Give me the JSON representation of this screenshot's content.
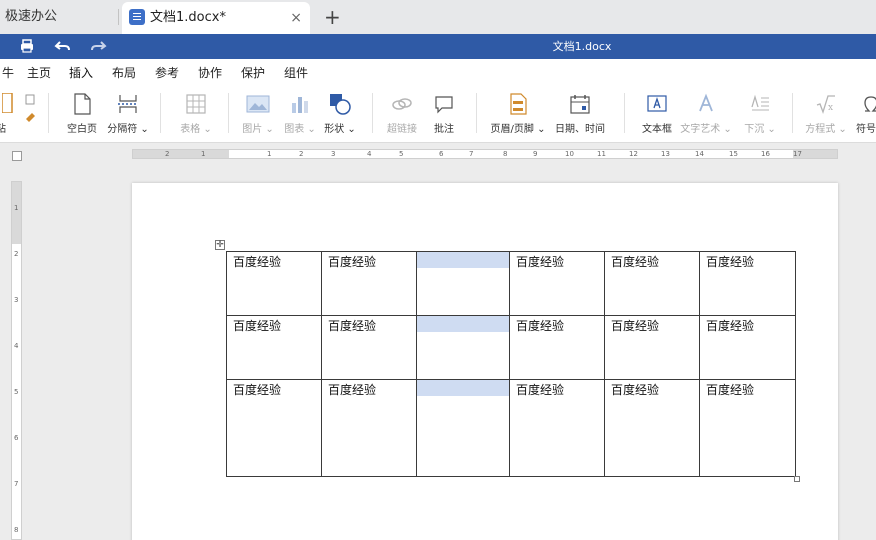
{
  "tabs": {
    "app_name": "极速办公",
    "document_tab": "文档1.docx*",
    "close_glyph": "×",
    "new_glyph": "+"
  },
  "titlebar": {
    "title": "文档1.docx",
    "icons": [
      "print-icon",
      "undo-icon",
      "redo-icon"
    ]
  },
  "menu": {
    "items": [
      "牛",
      "主页",
      "插入",
      "布局",
      "参考",
      "协作",
      "保护",
      "组件"
    ],
    "active": "插入"
  },
  "ribbon": {
    "partial_left_label": "粘",
    "items": [
      {
        "name": "blank-page",
        "label": "空白页",
        "enabled": true
      },
      {
        "name": "separator",
        "label": "分隔符 ⌄",
        "enabled": true
      },
      {
        "name": "table",
        "label": "表格 ⌄",
        "enabled": false
      },
      {
        "name": "image",
        "label": "图片 ⌄",
        "enabled": false
      },
      {
        "name": "chart",
        "label": "图表 ⌄",
        "enabled": false
      },
      {
        "name": "shape",
        "label": "形状 ⌄",
        "enabled": true
      },
      {
        "name": "hyperlink",
        "label": "超链接",
        "enabled": false
      },
      {
        "name": "comment",
        "label": "批注",
        "enabled": true
      },
      {
        "name": "header-footer",
        "label": "页眉/页脚 ⌄",
        "enabled": true
      },
      {
        "name": "date-time",
        "label": "日期、时间",
        "enabled": true
      },
      {
        "name": "text-box",
        "label": "文本框",
        "enabled": true
      },
      {
        "name": "text-art",
        "label": "文字艺术 ⌄",
        "enabled": false
      },
      {
        "name": "drop-cap",
        "label": "下沉 ⌄",
        "enabled": false
      },
      {
        "name": "equation",
        "label": "方程式 ⌄",
        "enabled": false
      },
      {
        "name": "symbol",
        "label": "符号",
        "enabled": true
      }
    ]
  },
  "ruler": {
    "h_labels": [
      "2",
      "1",
      "1",
      "2",
      "3",
      "4",
      "5",
      "6",
      "7",
      "8",
      "9",
      "10",
      "11",
      "12",
      "13",
      "14",
      "15",
      "16",
      "17"
    ],
    "v_labels": [
      "1",
      "2",
      "3",
      "4",
      "5",
      "6",
      "7",
      "8"
    ]
  },
  "table": {
    "rows": [
      [
        "百度经验",
        "百度经验",
        "",
        "百度经验",
        "百度经验",
        "百度经验"
      ],
      [
        "百度经验",
        "百度经验",
        "",
        "百度经验",
        "百度经验",
        "百度经验"
      ],
      [
        "百度经验",
        "百度经验",
        "",
        "百度经验",
        "百度经验",
        "百度经验"
      ]
    ],
    "selected_column": 2,
    "move_handle_glyph": "✛"
  }
}
